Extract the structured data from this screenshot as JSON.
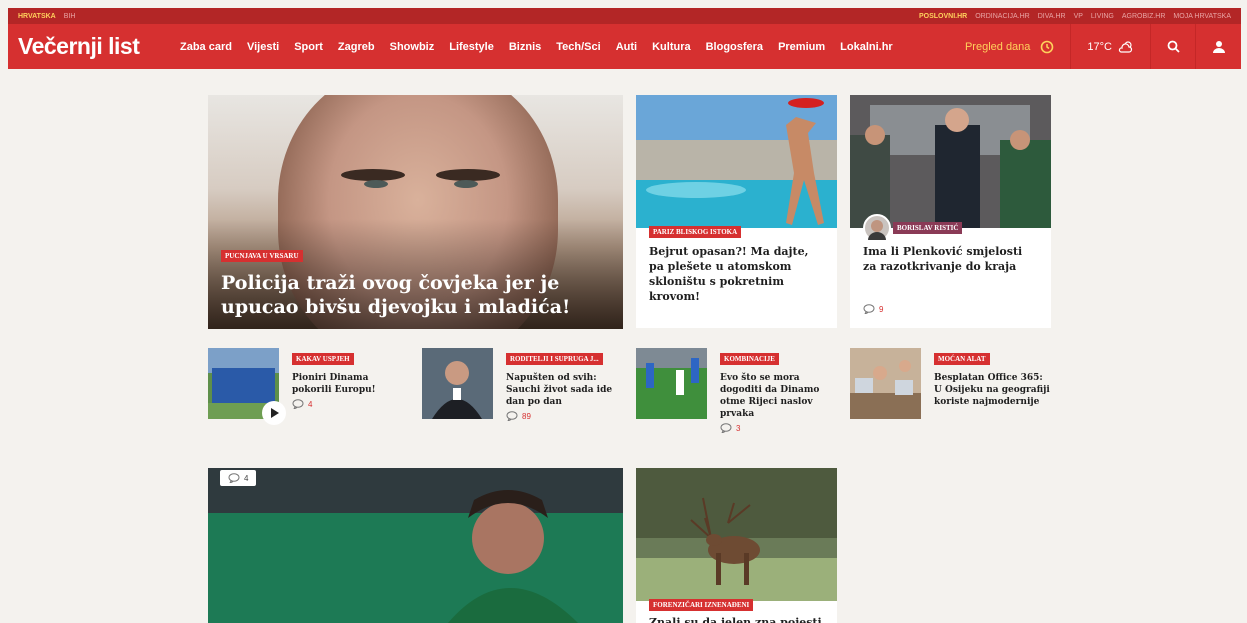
{
  "topbar": {
    "left": [
      "HRVATSKA",
      "BIH"
    ],
    "right": [
      "POSLOVNI.HR",
      "ORDINACIJA.HR",
      "DIVA.HR",
      "VP",
      "LIVING",
      "AGROBIZ.HR",
      "MOJA HRVATSKA"
    ]
  },
  "header": {
    "logo": "Večernji list",
    "menu": [
      "Zaba card",
      "Vijesti",
      "Sport",
      "Zagreb",
      "Showbiz",
      "Lifestyle",
      "Biznis",
      "Tech/Sci",
      "Auti",
      "Kultura",
      "Blogosfera",
      "Premium",
      "Lokalni.hr"
    ],
    "pregled": "Pregled dana",
    "temperature": "17°C"
  },
  "hero": {
    "tag": "PUCNJAVA U VRSARU",
    "title": "Policija traži ovog čovjeka jer je upucao bivšu djevojku i mladića!"
  },
  "card2": {
    "tag": "PARIZ BLISKOG ISTOKA",
    "title": "Bejrut opasan?! Ma dajte, pa plešete u atomskom skloništu s pokretnim krovom!"
  },
  "card3": {
    "tag": "BORISLAV RISTIĆ",
    "title": "Ima li Plenković smjelosti za razotkrivanje do kraja",
    "comments": "9"
  },
  "small": [
    {
      "tag": "KAKAV USPJEH",
      "title": "Pioniri Dinama pokorili Europu!",
      "comments": "4"
    },
    {
      "tag": "RODITELJI I SUPRUGA J...",
      "title": "Napušten od svih: Sauchi život sada ide dan po dan",
      "comments": "89"
    },
    {
      "tag": "KOMBINACIJE",
      "title": "Evo što se mora dogoditi da Dinamo otme Rijeci naslov prvaka",
      "comments": "3"
    },
    {
      "tag": "MOĆAN ALAT",
      "title": "Besplatan Office 365: U Osijeku na geografiji koriste najmodernije",
      "comments": ""
    }
  ],
  "bottom1": {
    "comments": "4"
  },
  "bottom2": {
    "tag": "FORENZIČARI IZNENAĐENI",
    "title": "Znali su da jelen zna pojesti"
  },
  "colors": {
    "brand": "#d63030",
    "topbar": "#b32626",
    "accent": "#ffd15c"
  }
}
